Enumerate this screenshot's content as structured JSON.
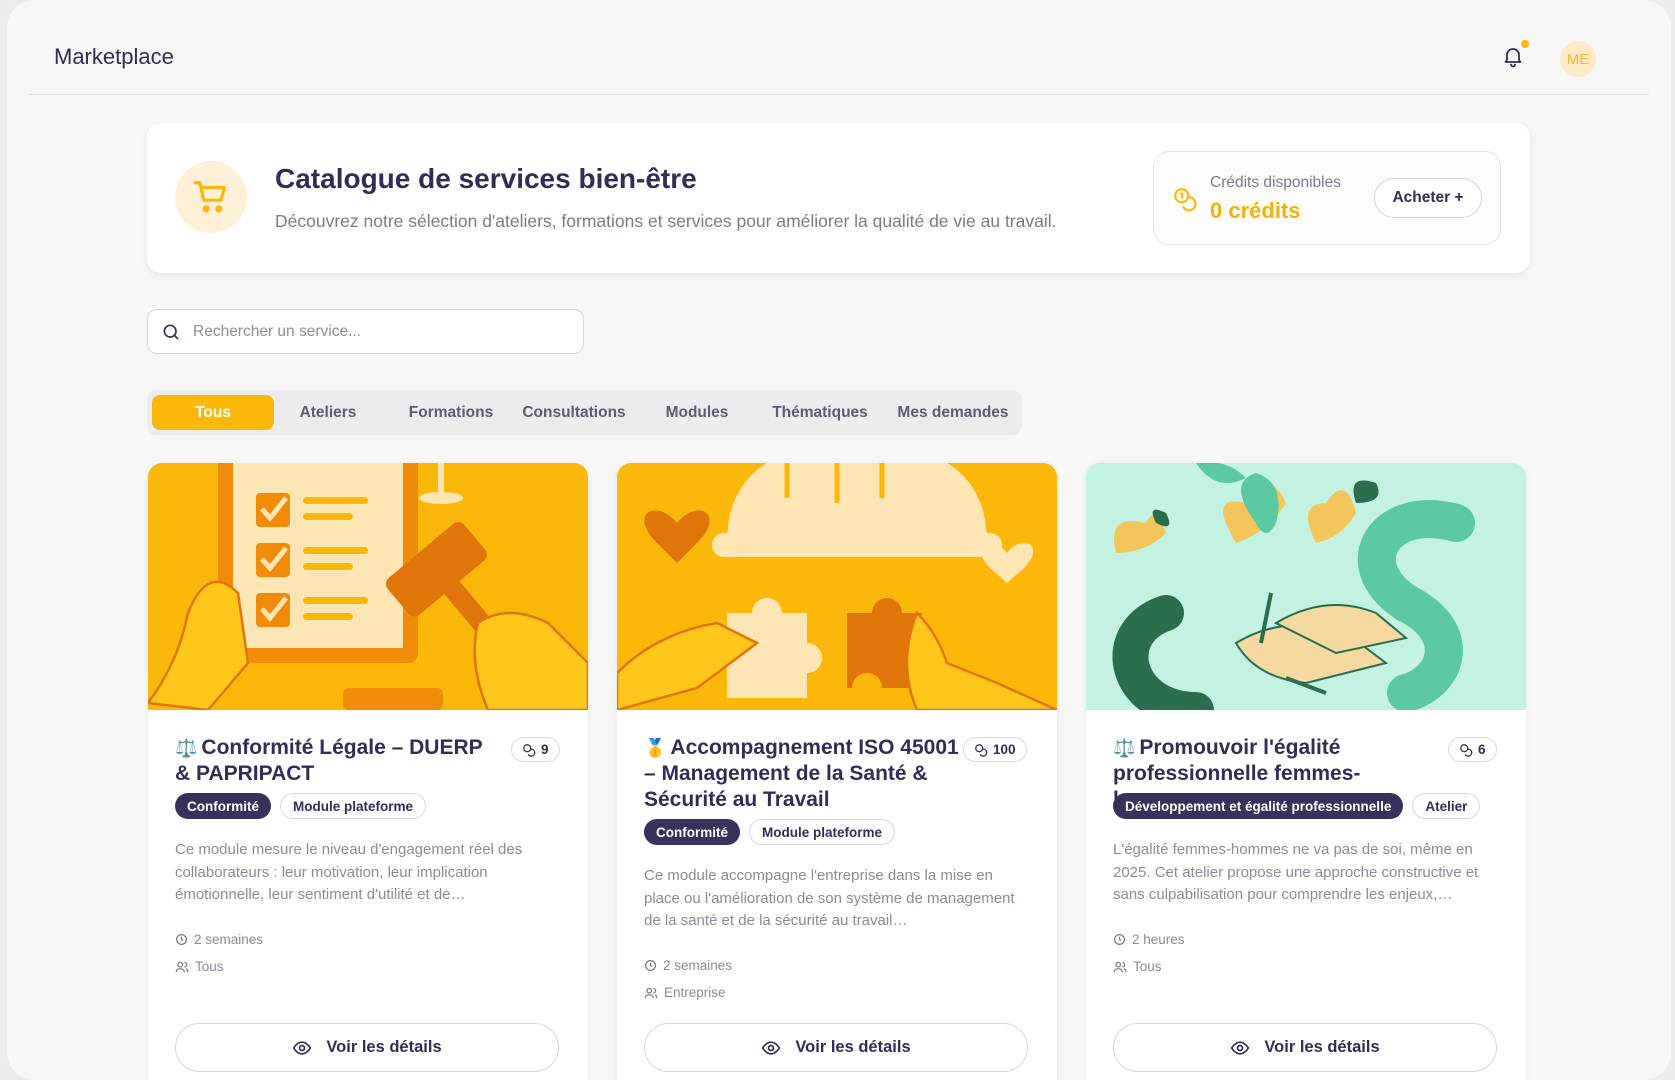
{
  "header": {
    "title": "Marketplace",
    "avatar_initials": "ME"
  },
  "hero": {
    "title": "Catalogue de services bien-être",
    "subtitle": "Découvrez notre sélection d'ateliers, formations et services pour améliorer la qualité de vie au travail.",
    "credits_label": "Crédits disponibles",
    "credits_value": "0 crédits",
    "buy_label": "Acheter +"
  },
  "search": {
    "placeholder": "Rechercher un service..."
  },
  "tabs": [
    "Tous",
    "Ateliers",
    "Formations",
    "Consultations",
    "Modules",
    "Thématiques",
    "Mes demandes"
  ],
  "active_tab": "Tous",
  "cards": [
    {
      "emoji": "⚖️",
      "title": "Conformité Légale – DUERP & PAPRIPACT",
      "count": "9",
      "tags": [
        "Conformité",
        "Module plateforme"
      ],
      "description": "Ce module mesure le niveau d'engagement réel des collaborateurs : leur motivation, leur implication émotionnelle, leur sentiment d'utilité et de…",
      "duration": "2 semaines",
      "audience": "Tous",
      "button": "Voir les détails",
      "theme": "orange"
    },
    {
      "emoji": "🥇",
      "title": "Accompagnement ISO 45001 – Management de la Santé & Sécurité au Travail",
      "count": "100",
      "tags": [
        "Conformité",
        "Module plateforme"
      ],
      "description": "Ce module accompagne l'entreprise dans la mise en place ou l'amélioration de son système de management de la santé et de la sécurité au travail…",
      "duration": "2 semaines",
      "audience": "Entreprise",
      "button": "Voir les détails",
      "theme": "orange"
    },
    {
      "emoji": "⚖️",
      "title": "Promouvoir l'égalité professionnelle femmes-hommes",
      "count": "6",
      "tags": [
        "Développement et égalité professionnelle",
        "Atelier"
      ],
      "description": "L'égalité femmes-hommes ne va pas de soi, même en 2025. Cet atelier propose une approche constructive et sans culpabilisation pour comprendre les enjeux,…",
      "duration": "2 heures",
      "audience": "Tous",
      "button": "Voir les détails",
      "theme": "green"
    }
  ],
  "colors": {
    "accent": "#fbb80a",
    "primary_dark": "#35335c",
    "green": "#c4f2e2"
  }
}
